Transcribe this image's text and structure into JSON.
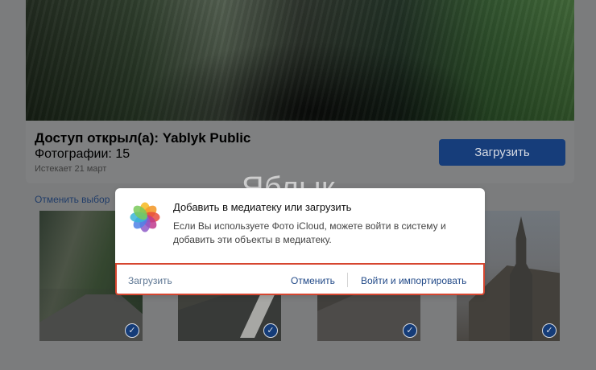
{
  "album": {
    "title": "Доступ открыл(а): Yablyk Public",
    "photos_count": "Фотографии: 15",
    "expiry": "Истекает 21 март",
    "upload_button": "Загрузить"
  },
  "selection": {
    "deselect_label": "Отменить выбор"
  },
  "watermark": {
    "text": "Яблык"
  },
  "dialog": {
    "title": "Добавить в медиатеку или загрузить",
    "message": "Если Вы используете Фото iCloud, можете войти в систему и добавить эти объекты в медиатеку.",
    "actions": {
      "upload": "Загрузить",
      "cancel": "Отменить",
      "sign_in_import": "Войти и импортировать"
    }
  },
  "icons": {
    "photos_app": "photos-icon",
    "selected_check": "check-icon"
  },
  "colors": {
    "overlay": "#7b7c7d",
    "primary_button": "#163d7a",
    "link": "#234b89",
    "highlight_border": "#d64630"
  },
  "thumbnails": [
    {
      "check": "✓"
    },
    {
      "check": "✓"
    },
    {
      "check": "✓"
    },
    {
      "check": "✓"
    }
  ]
}
